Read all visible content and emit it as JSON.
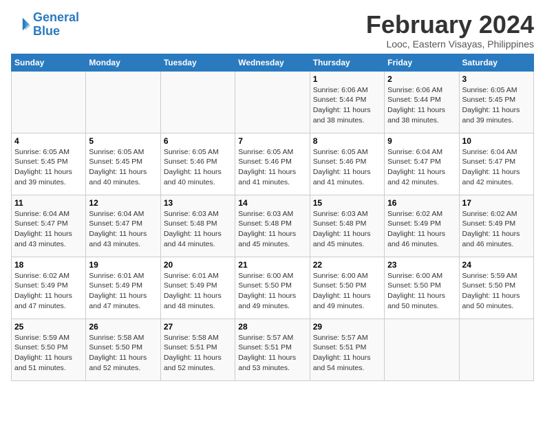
{
  "header": {
    "logo_line1": "General",
    "logo_line2": "Blue",
    "month": "February 2024",
    "location": "Looc, Eastern Visayas, Philippines"
  },
  "weekdays": [
    "Sunday",
    "Monday",
    "Tuesday",
    "Wednesday",
    "Thursday",
    "Friday",
    "Saturday"
  ],
  "weeks": [
    [
      {
        "day": "",
        "info": ""
      },
      {
        "day": "",
        "info": ""
      },
      {
        "day": "",
        "info": ""
      },
      {
        "day": "",
        "info": ""
      },
      {
        "day": "1",
        "info": "Sunrise: 6:06 AM\nSunset: 5:44 PM\nDaylight: 11 hours\nand 38 minutes."
      },
      {
        "day": "2",
        "info": "Sunrise: 6:06 AM\nSunset: 5:44 PM\nDaylight: 11 hours\nand 38 minutes."
      },
      {
        "day": "3",
        "info": "Sunrise: 6:05 AM\nSunset: 5:45 PM\nDaylight: 11 hours\nand 39 minutes."
      }
    ],
    [
      {
        "day": "4",
        "info": "Sunrise: 6:05 AM\nSunset: 5:45 PM\nDaylight: 11 hours\nand 39 minutes."
      },
      {
        "day": "5",
        "info": "Sunrise: 6:05 AM\nSunset: 5:45 PM\nDaylight: 11 hours\nand 40 minutes."
      },
      {
        "day": "6",
        "info": "Sunrise: 6:05 AM\nSunset: 5:46 PM\nDaylight: 11 hours\nand 40 minutes."
      },
      {
        "day": "7",
        "info": "Sunrise: 6:05 AM\nSunset: 5:46 PM\nDaylight: 11 hours\nand 41 minutes."
      },
      {
        "day": "8",
        "info": "Sunrise: 6:05 AM\nSunset: 5:46 PM\nDaylight: 11 hours\nand 41 minutes."
      },
      {
        "day": "9",
        "info": "Sunrise: 6:04 AM\nSunset: 5:47 PM\nDaylight: 11 hours\nand 42 minutes."
      },
      {
        "day": "10",
        "info": "Sunrise: 6:04 AM\nSunset: 5:47 PM\nDaylight: 11 hours\nand 42 minutes."
      }
    ],
    [
      {
        "day": "11",
        "info": "Sunrise: 6:04 AM\nSunset: 5:47 PM\nDaylight: 11 hours\nand 43 minutes."
      },
      {
        "day": "12",
        "info": "Sunrise: 6:04 AM\nSunset: 5:47 PM\nDaylight: 11 hours\nand 43 minutes."
      },
      {
        "day": "13",
        "info": "Sunrise: 6:03 AM\nSunset: 5:48 PM\nDaylight: 11 hours\nand 44 minutes."
      },
      {
        "day": "14",
        "info": "Sunrise: 6:03 AM\nSunset: 5:48 PM\nDaylight: 11 hours\nand 45 minutes."
      },
      {
        "day": "15",
        "info": "Sunrise: 6:03 AM\nSunset: 5:48 PM\nDaylight: 11 hours\nand 45 minutes."
      },
      {
        "day": "16",
        "info": "Sunrise: 6:02 AM\nSunset: 5:49 PM\nDaylight: 11 hours\nand 46 minutes."
      },
      {
        "day": "17",
        "info": "Sunrise: 6:02 AM\nSunset: 5:49 PM\nDaylight: 11 hours\nand 46 minutes."
      }
    ],
    [
      {
        "day": "18",
        "info": "Sunrise: 6:02 AM\nSunset: 5:49 PM\nDaylight: 11 hours\nand 47 minutes."
      },
      {
        "day": "19",
        "info": "Sunrise: 6:01 AM\nSunset: 5:49 PM\nDaylight: 11 hours\nand 47 minutes."
      },
      {
        "day": "20",
        "info": "Sunrise: 6:01 AM\nSunset: 5:49 PM\nDaylight: 11 hours\nand 48 minutes."
      },
      {
        "day": "21",
        "info": "Sunrise: 6:00 AM\nSunset: 5:50 PM\nDaylight: 11 hours\nand 49 minutes."
      },
      {
        "day": "22",
        "info": "Sunrise: 6:00 AM\nSunset: 5:50 PM\nDaylight: 11 hours\nand 49 minutes."
      },
      {
        "day": "23",
        "info": "Sunrise: 6:00 AM\nSunset: 5:50 PM\nDaylight: 11 hours\nand 50 minutes."
      },
      {
        "day": "24",
        "info": "Sunrise: 5:59 AM\nSunset: 5:50 PM\nDaylight: 11 hours\nand 50 minutes."
      }
    ],
    [
      {
        "day": "25",
        "info": "Sunrise: 5:59 AM\nSunset: 5:50 PM\nDaylight: 11 hours\nand 51 minutes."
      },
      {
        "day": "26",
        "info": "Sunrise: 5:58 AM\nSunset: 5:50 PM\nDaylight: 11 hours\nand 52 minutes."
      },
      {
        "day": "27",
        "info": "Sunrise: 5:58 AM\nSunset: 5:51 PM\nDaylight: 11 hours\nand 52 minutes."
      },
      {
        "day": "28",
        "info": "Sunrise: 5:57 AM\nSunset: 5:51 PM\nDaylight: 11 hours\nand 53 minutes."
      },
      {
        "day": "29",
        "info": "Sunrise: 5:57 AM\nSunset: 5:51 PM\nDaylight: 11 hours\nand 54 minutes."
      },
      {
        "day": "",
        "info": ""
      },
      {
        "day": "",
        "info": ""
      }
    ]
  ]
}
